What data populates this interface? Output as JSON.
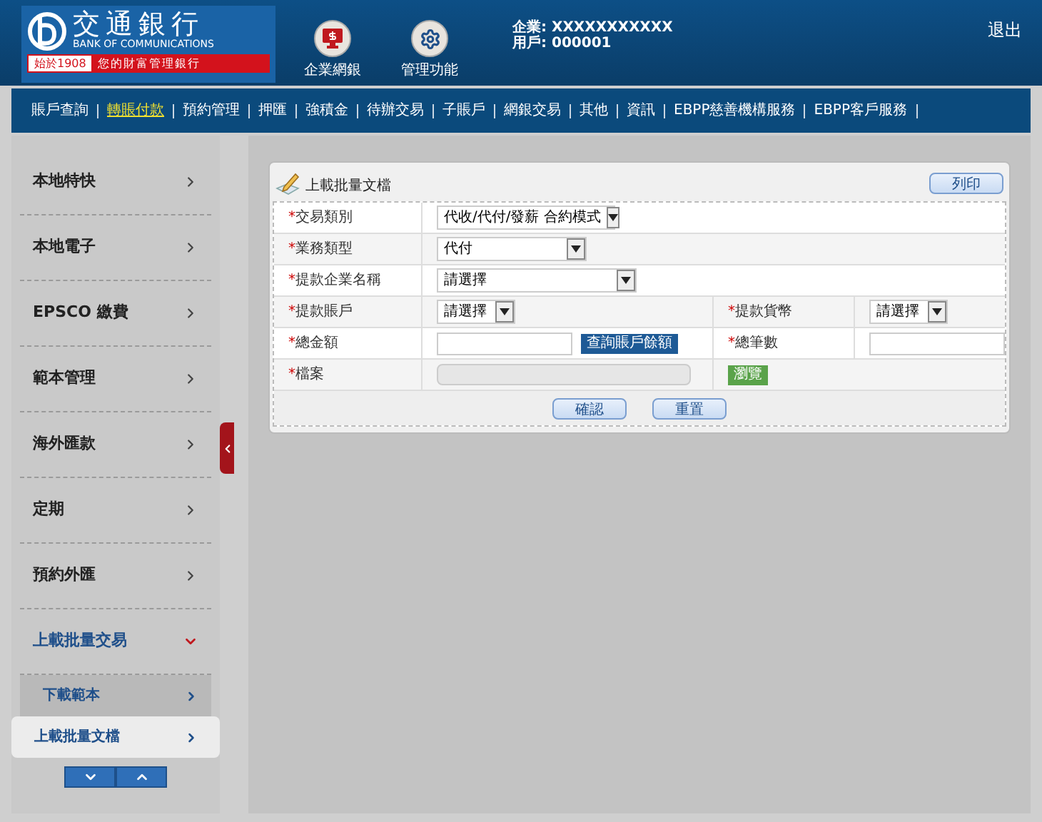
{
  "header": {
    "logo": {
      "name_zh": "交通銀行",
      "name_en": "BANK OF COMMUNICATIONS",
      "since": "始於1908",
      "slogan": "您的財富管理銀行"
    },
    "shortcuts": [
      {
        "kind": "monitor",
        "label": "企業網銀"
      },
      {
        "kind": "gear",
        "label": "管理功能"
      }
    ],
    "user": {
      "company": "企業: XXXXXXXXXXX",
      "user": "用戶: 000001"
    },
    "logout": "退出"
  },
  "nav": [
    {
      "label": "賬戶查詢",
      "selected": false
    },
    {
      "label": "轉賬付款",
      "selected": true
    },
    {
      "label": "預約管理",
      "selected": false
    },
    {
      "label": "押匯",
      "selected": false
    },
    {
      "label": "強積金",
      "selected": false
    },
    {
      "label": "待辦交易",
      "selected": false
    },
    {
      "label": "子賬戶",
      "selected": false
    },
    {
      "label": "網銀交易",
      "selected": false
    },
    {
      "label": "其他",
      "selected": false
    },
    {
      "label": "資訊",
      "selected": false
    },
    {
      "label": "EBPP慈善機構服務",
      "selected": false
    },
    {
      "label": "EBPP客戶服務",
      "selected": false
    }
  ],
  "sidebar": {
    "items": [
      {
        "label": "本地特快",
        "expanded": false
      },
      {
        "label": "本地電子",
        "expanded": false
      },
      {
        "label": "EPSCO 繳費",
        "expanded": false
      },
      {
        "label": "範本管理",
        "expanded": false
      },
      {
        "label": "海外匯款",
        "expanded": false
      },
      {
        "label": "定期",
        "expanded": false
      },
      {
        "label": "預約外匯",
        "expanded": false
      },
      {
        "label": "上載批量交易",
        "expanded": true,
        "children": [
          {
            "label": "下載範本",
            "selected": false
          },
          {
            "label": "上載批量文檔",
            "selected": true
          }
        ]
      }
    ]
  },
  "form": {
    "title": "上載批量文檔",
    "print_button": "列印",
    "rows": [
      {
        "cells": [
          {
            "mark": "*",
            "label": "交易類別",
            "controls": [
              {
                "kind": "select",
                "value": "代收/代付/發薪 合約模式"
              }
            ]
          }
        ]
      },
      {
        "cells": [
          {
            "mark": "*",
            "label": "業務類型",
            "controls": [
              {
                "kind": "select",
                "value": "代付"
              }
            ]
          }
        ]
      },
      {
        "cells": [
          {
            "mark": "*",
            "label": "提款企業名稱",
            "controls": [
              {
                "kind": "select",
                "value": "請選擇"
              }
            ]
          }
        ]
      },
      {
        "cells": [
          {
            "mark": "*",
            "label": "提款賬戶",
            "controls": [
              {
                "kind": "select",
                "value": "請選擇"
              }
            ]
          },
          {
            "mark": "*",
            "label": "提款貨幣",
            "controls": [
              {
                "kind": "select",
                "value": "請選擇"
              }
            ]
          }
        ]
      },
      {
        "cells": [
          {
            "mark": "*",
            "label": "總金額",
            "controls": [
              {
                "kind": "input",
                "disabled": false
              },
              {
                "kind": "action",
                "text": "查詢賬戶餘額"
              }
            ]
          },
          {
            "mark": "*",
            "label": "總筆數",
            "controls": [
              {
                "kind": "input",
                "disabled": false
              }
            ]
          }
        ]
      },
      {
        "cells": [
          {
            "mark": "*",
            "label": "檔案",
            "controls": [
              {
                "kind": "input",
                "disabled": true
              }
            ]
          },
          {
            "controls": [
              {
                "kind": "browse",
                "text": "瀏覽"
              }
            ]
          }
        ]
      }
    ],
    "buttons": [
      "確認",
      "重置"
    ]
  }
}
